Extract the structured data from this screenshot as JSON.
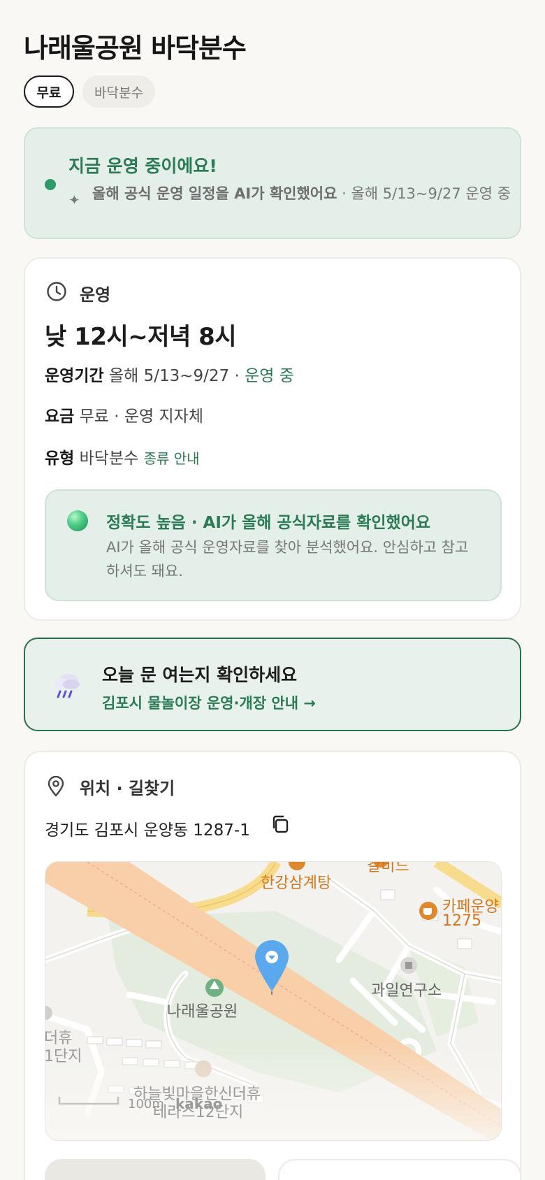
{
  "header": {
    "title": "나래울공원 바닥분수",
    "chips": {
      "free": "무료",
      "type": "바닥분수"
    }
  },
  "status": {
    "title": "지금 운영 중이에요!",
    "sparkle": "✦",
    "sub_bold": "올해 공식 운영 일정을 AI가 확인했어요",
    "sub_rest": " · 올해 5/13~9/27 운영 중"
  },
  "operation": {
    "label": "운영",
    "hours": "낮 12시~저녁 8시",
    "period_label": "운영기간",
    "period_value": "올해 5/13~9/27 · ",
    "period_status": "운영 중",
    "fee_label": "요금",
    "fee_value": "무료 · 운영 지자체",
    "type_label": "유형",
    "type_value": "바닥분수",
    "type_link": "종류 안내",
    "accuracy": {
      "title": "정확도 높음 · AI가 올해 공식자료를 확인했어요",
      "desc": "AI가 올해 공식 운영자료를 찾아 분석했어요. 안심하고 참고하셔도 돼요."
    }
  },
  "notice": {
    "title": "오늘 문 여는지 확인하세요",
    "link": "김포시 물놀이장 운영·개장 안내 →"
  },
  "location": {
    "label": "위치 · 길찾기",
    "address": "경기도 김포시 운양동 1287-1",
    "map": {
      "pois": {
        "samgyetang": "한강삼계탕",
        "cafe_1": "카페운양",
        "cafe_2": "1275",
        "lab": "과일연구소",
        "park": "나래울공원",
        "apt_1": "하늘빛마을한신더휴",
        "apt_2": "테라스12단지",
        "left_1": "더휴",
        "left_2": "1단지",
        "top_partial": "갈비드",
        "scale": "100m",
        "logo": "kakao"
      }
    }
  },
  "icons": {
    "clock": "clock-icon",
    "pin": "location-pin-icon",
    "copy": "copy-icon",
    "rain": "rain-cloud-icon",
    "accuracy": "green-ball-icon"
  },
  "colors": {
    "accent_green": "#2a7a54",
    "status_bg": "#e5efe9",
    "page_bg": "#f9f8f4",
    "map_marker": "#5aa8ee",
    "poi_orange": "#d4761c"
  }
}
